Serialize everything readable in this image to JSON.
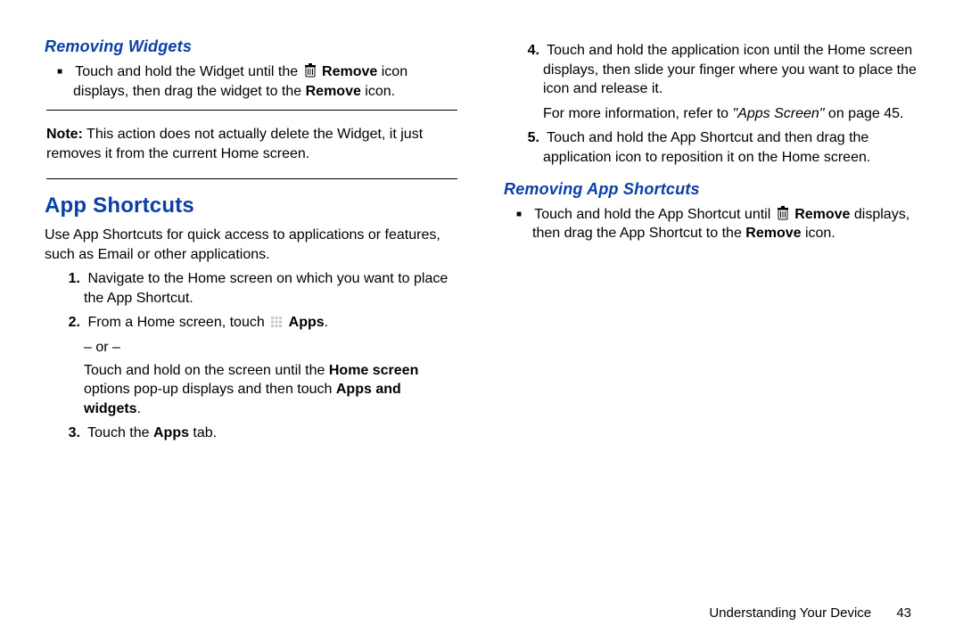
{
  "left": {
    "removing_widgets_heading": "Removing Widgets",
    "rw_bullet_pre": "Touch and hold the Widget until the ",
    "rw_bullet_bold1": "Remove",
    "rw_bullet_mid": " icon displays, then drag the widget to the ",
    "rw_bullet_bold2": "Remove",
    "rw_bullet_post": " icon.",
    "note_label": "Note:",
    "note_text": " This action does not actually delete the Widget, it just removes it from the current Home screen.",
    "app_shortcuts_heading": "App Shortcuts",
    "as_intro": "Use App Shortcuts for quick access to applications or features, such as Email or other applications.",
    "step1_num": "1.",
    "step1": "Navigate to the Home screen on which you want to place the App Shortcut.",
    "step2_num": "2.",
    "step2_pre": "From a Home screen, touch ",
    "step2_bold": "Apps",
    "step2_post": ".",
    "step2_or": "– or –",
    "step2b_pre": "Touch and hold on the screen until the ",
    "step2b_bold1": "Home screen",
    "step2b_mid": " options pop-up displays and then touch ",
    "step2b_bold2": "Apps and widgets",
    "step2b_post": ".",
    "step3_num": "3.",
    "step3_pre": "Touch the ",
    "step3_bold": "Apps",
    "step3_post": " tab."
  },
  "right": {
    "step4_num": "4.",
    "step4": "Touch and hold the application icon until the Home screen displays, then slide your finger where you want to place the icon and release it.",
    "step4b_pre": "For more information, refer to ",
    "step4b_italic": "\"Apps Screen\"",
    "step4b_post": " on page 45.",
    "step5_num": "5.",
    "step5": "Touch and hold the App Shortcut and then drag the application icon to reposition it on the Home screen.",
    "ras_heading": "Removing App Shortcuts",
    "ras_pre": "Touch and hold the App Shortcut until ",
    "ras_bold1": "Remove",
    "ras_mid": " displays, then drag the App Shortcut to the ",
    "ras_bold2": "Remove",
    "ras_post": " icon."
  },
  "footer": {
    "section": "Understanding Your Device",
    "page": "43"
  }
}
